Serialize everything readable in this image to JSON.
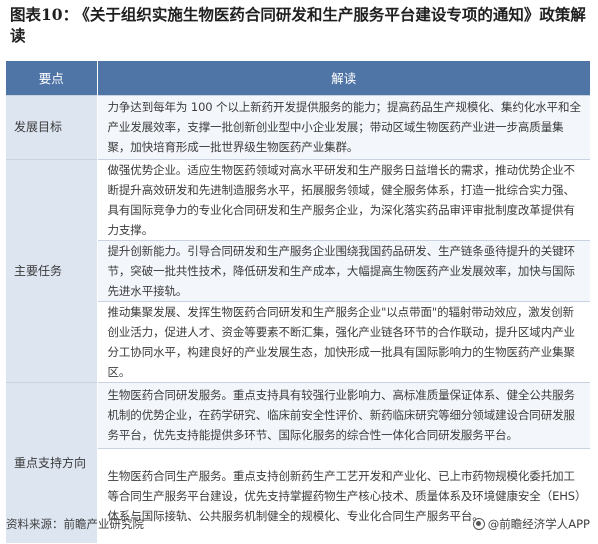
{
  "title": {
    "label": "图表10：",
    "text": "《关于组织实施生物医药合同研发和生产服务平台建设专项的通知》政策解读"
  },
  "table": {
    "headers": [
      "要点",
      "解读"
    ],
    "groups": [
      {
        "key": "发展目标",
        "items": [
          "力争达到每年为 100 个以上新药开发提供服务的能力；提高药品生产规模化、集约化水平和全产业发展效率，支撑一批创新创业型中小企业发展；带动区域生物医药产业进一步高质量集聚，加快培育形成一批世界级生物医药产业集群。"
        ]
      },
      {
        "key": "主要任务",
        "items": [
          "做强优势企业。适应生物医药领域对高水平研发和生产服务日益增长的需求，推动优势企业不断提升高效研发和先进制造服务水平，拓展服务领域，健全服务体系，打造一批综合实力强、具有国际竞争力的专业化合同研发和生产服务企业，为深化落实药品审评审批制度改革提供有力支撑。",
          "提升创新能力。引导合同研发和生产服务企业围绕我国药品研发、生产链条亟待提升的关键环节，突破一批共性技术，降低研发和生产成本，大幅提高生物医药产业发展效率，加快与国际先进水平接轨。",
          "推动集聚发展、发挥生物医药合同研发和生产服务企业\"以点带面\"的辐射带动效应，激发创新创业活力，促进人才、资金等要素不断汇集，强化产业链各环节的合作联动，提升区域内产业分工协同水平，构建良好的产业发展生态，加快形成一批具有国际影响力的生物医药产业集聚区。"
        ]
      },
      {
        "key": "重点支持方向",
        "items": [
          "生物医药合同研发服务。重点支持具有较强行业影响力、高标准质量保证体系、健全公共服务机制的优势企业，在药学研究、临床前安全性评价、新药临床研究等细分领域建设合同研发服务平台，优先支持能提供多环节、国际化服务的综合性一体化合同研发服务平台。",
          "生物医药合同生产服务。重点支持创新药生产工艺开发和产业化、已上市药物规模化委托加工等合同生产服务平台建设，优先支持掌握药物生产核心技术、质量体系及环境健康安全（EHS）体系与国际接轨、公共服务机制健全的规模化、专业化合同生产服务平台。"
        ]
      }
    ]
  },
  "footer": {
    "source": "资料来源：前瞻产业研究院",
    "brand": "@前瞻经济学人APP",
    "brand_icon": "qianzhan-logo-icon"
  }
}
